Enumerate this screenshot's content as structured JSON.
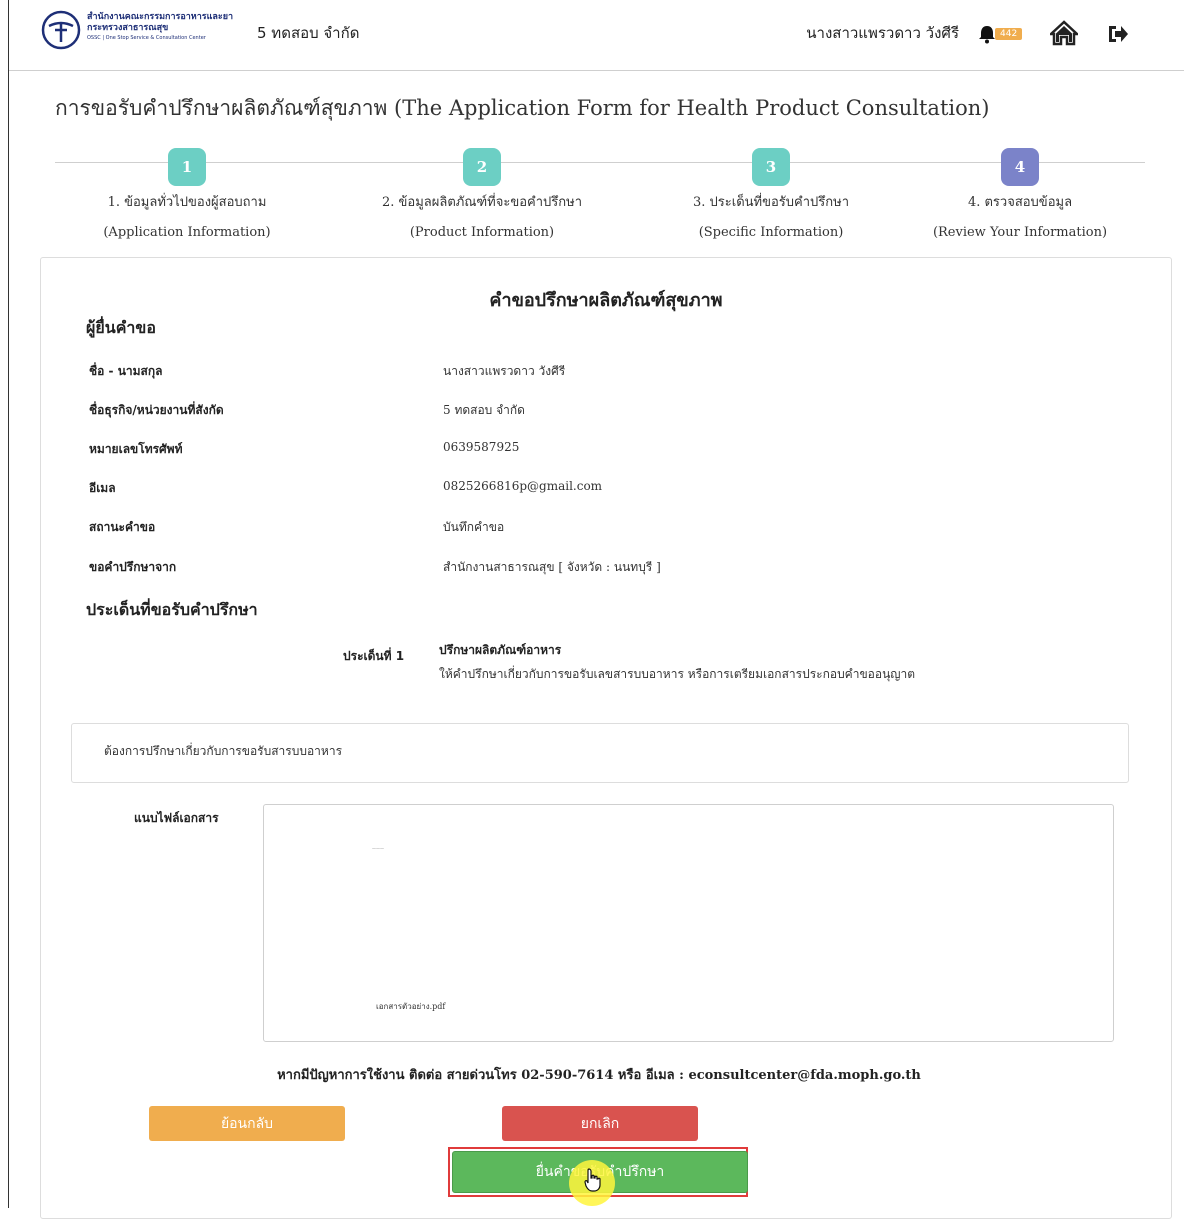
{
  "header": {
    "logo_line1": "สำนักงานคณะกรรมการอาหารและยา",
    "logo_line2": "กระทรวงสาธารณสุข",
    "logo_line3": "OSSC | One Stop Service & Consultation Center",
    "company": "5 ทดสอบ จำกัด",
    "user_name": "นางสาวแพรวดาว วังศีรี",
    "notification_count": "442",
    "icons": [
      "fda-logo-icon",
      "bell-icon",
      "home-icon",
      "logout-icon"
    ]
  },
  "page": {
    "title": "การขอรับคำปรึกษาผลิตภัณฑ์สุขภาพ (The Application Form for Health Product Consultation)"
  },
  "steps": [
    {
      "num": "1",
      "label": "1. ข้อมูลทั่วไปของผู้สอบถาม",
      "sub": "(Application Information)",
      "color": "#6ccfc4"
    },
    {
      "num": "2",
      "label": "2. ข้อมูลผลิตภัณฑ์ที่จะขอคำปรึกษา",
      "sub": "(Product Information)",
      "color": "#6ccfc4"
    },
    {
      "num": "3",
      "label": "3. ประเด็นที่ขอรับคำปรึกษา",
      "sub": "(Specific Information)",
      "color": "#6ccfc4"
    },
    {
      "num": "4",
      "label": "4. ตรวจสอบข้อมูล",
      "sub": "(Review Your Information)",
      "color": "#7b83c9"
    }
  ],
  "form": {
    "title": "คำขอปรึกษาผลิตภัณฑ์สุขภาพ",
    "applicant_heading": "ผู้ยื่นคำขอ",
    "rows": [
      {
        "label": "ชื่อ - นามสกุล",
        "value": "นางสาวแพรวดาว วังศีรี"
      },
      {
        "label": "ชื่อธุรกิจ/หน่วยงานที่สังกัด",
        "value": "5 ทดสอบ จำกัด"
      },
      {
        "label": "หมายเลขโทรศัพท์",
        "value": "0639587925"
      },
      {
        "label": "อีเมล",
        "value": "0825266816p@gmail.com"
      },
      {
        "label": "สถานะคำขอ",
        "value": "บันทึกคำขอ"
      },
      {
        "label": "ขอคำปรึกษาจาก",
        "value": "สำนักงานสาธารณสุข [ จังหวัด : นนทบุรี ]"
      }
    ],
    "topics_heading": "ประเด็นที่ขอรับคำปรึกษา",
    "topic": {
      "label": "ประเด็นที่ 1",
      "title": "ปรึกษาผลิตภัณฑ์อาหาร",
      "description": "ให้คำปรึกษาเกี่ยวกับการขอรับเลขสารบบอาหาร หรือการเตรียมเอกสารประกอบคำขออนุญาต"
    },
    "detail_text": "ต้องการปรึกษาเกี่ยวกับการขอรับสารบบอาหาร",
    "attachment_label": "แนบไฟล์เอกสาร",
    "attachment_filename": "เอกสารตัวอย่าง.pdf",
    "help_text": "หากมีปัญหาการใช้งาน ติดต่อ สายด่วนโทร 02-590-7614 หรือ อีเมล : econsultcenter@fda.moph.go.th"
  },
  "buttons": {
    "back": "ย้อนกลับ",
    "cancel": "ยกเลิก",
    "submit": "ยื่นคำขอรับคำปรึกษา"
  },
  "colors": {
    "back": "#f0ad4e",
    "cancel": "#d9534f",
    "submit": "#5cb85c",
    "highlight": "#e03b3b"
  }
}
